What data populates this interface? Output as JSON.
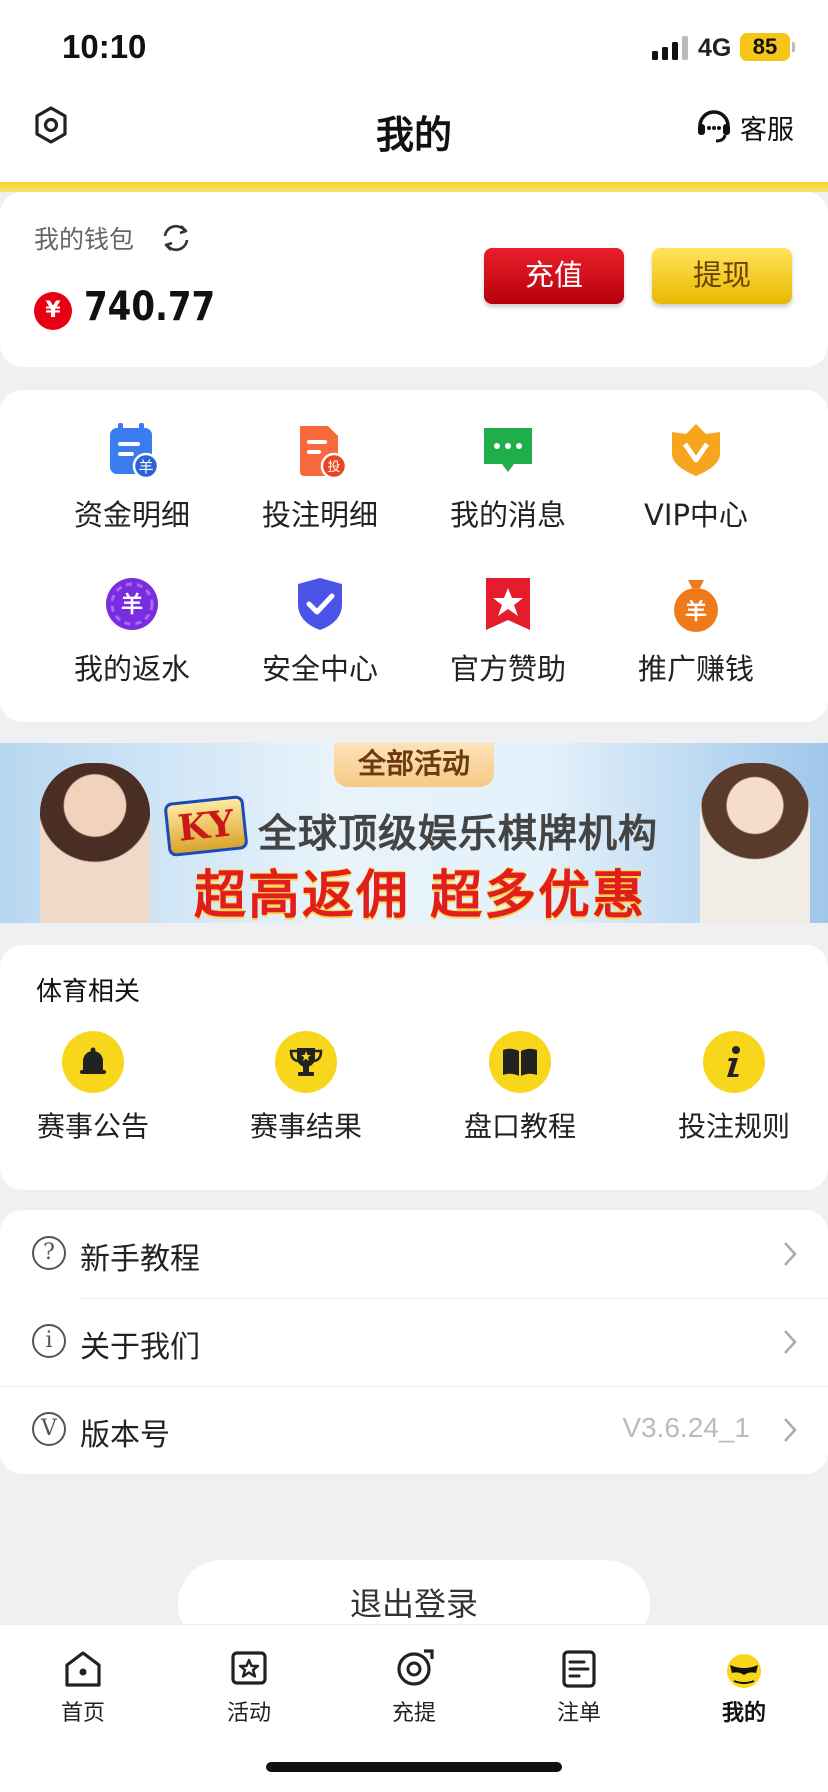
{
  "status_bar": {
    "time": "10:10",
    "network": "4G",
    "battery": "85"
  },
  "header": {
    "title": "我的",
    "customer_service": "客服"
  },
  "wallet": {
    "label": "我的钱包",
    "currency_symbol": "¥",
    "balance": "740.77",
    "recharge_label": "充值",
    "withdraw_label": "提现"
  },
  "shortcuts": [
    {
      "label": "资金明细",
      "icon": "fund-details-icon"
    },
    {
      "label": "投注明细",
      "icon": "bet-details-icon"
    },
    {
      "label": "我的消息",
      "icon": "message-icon"
    },
    {
      "label": "VIP中心",
      "icon": "vip-crown-icon"
    },
    {
      "label": "我的返水",
      "icon": "rebate-icon"
    },
    {
      "label": "安全中心",
      "icon": "shield-check-icon"
    },
    {
      "label": "官方赞助",
      "icon": "sponsor-star-icon"
    },
    {
      "label": "推广赚钱",
      "icon": "money-bag-icon"
    }
  ],
  "banner": {
    "tag": "全部活动",
    "logo": "KY",
    "line1": "全球顶级娱乐棋牌机构",
    "line2": "超高返佣 超多优惠"
  },
  "sports": {
    "title": "体育相关",
    "items": [
      {
        "label": "赛事公告",
        "icon": "bell-icon"
      },
      {
        "label": "赛事结果",
        "icon": "trophy-icon"
      },
      {
        "label": "盘口教程",
        "icon": "book-icon"
      },
      {
        "label": "投注规则",
        "icon": "info-icon"
      }
    ]
  },
  "menu": [
    {
      "label": "新手教程",
      "icon_char": "?",
      "value": ""
    },
    {
      "label": "关于我们",
      "icon_char": "i",
      "value": ""
    },
    {
      "label": "版本号",
      "icon_char": "V",
      "value": "V3.6.24_1"
    }
  ],
  "logout_label": "退出登录",
  "tabs": [
    {
      "label": "首页",
      "active": false
    },
    {
      "label": "活动",
      "active": false
    },
    {
      "label": "充提",
      "active": false
    },
    {
      "label": "注单",
      "active": false
    },
    {
      "label": "我的",
      "active": true
    }
  ],
  "colors": {
    "accent_yellow": "#f8d61c",
    "recharge_red": "#e8202a",
    "background": "#f0f0f2"
  }
}
